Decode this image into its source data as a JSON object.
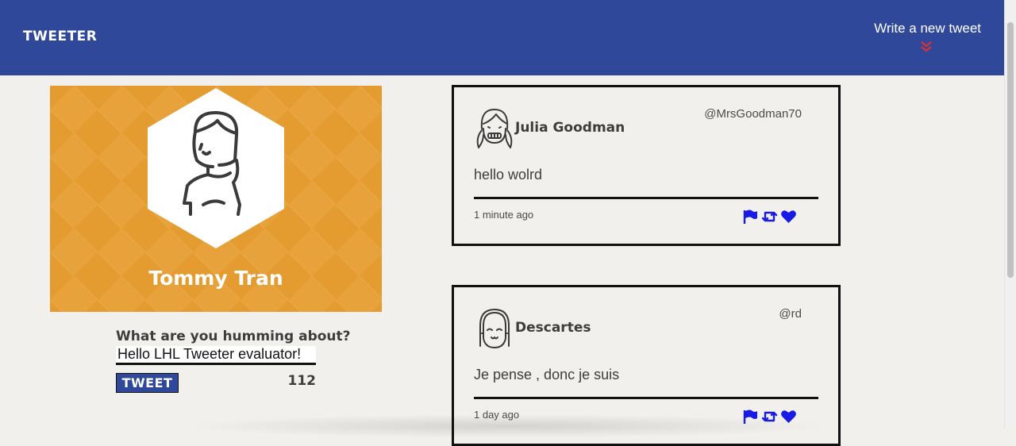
{
  "navbar": {
    "brand": "TWEETER",
    "compose_link": "Write a new tweet",
    "chevron_icon": "double-chevron-down-icon",
    "chevron_color": "#e03030"
  },
  "profile": {
    "name": "Tommy Tran",
    "avatar_icon": "user-avatar-icon",
    "background_color": "#e49b2f"
  },
  "compose": {
    "label": "What are you humming about?",
    "input_value": "Hello LHL Tweeter evaluator!",
    "button_label": "TWEET",
    "counter": "112"
  },
  "tweets": [
    {
      "name": "Julia Goodman",
      "handle": "@MrsGoodman70",
      "body": "hello wolrd",
      "time": "1 minute ago",
      "avatar_icon": "girl-avatar-icon"
    },
    {
      "name": "Descartes",
      "handle": "@rd",
      "body": "Je pense , donc je suis",
      "time": "1 day ago",
      "avatar_icon": "bob-haircut-avatar-icon"
    }
  ],
  "actions": {
    "icons": [
      "flag-icon",
      "retweet-icon",
      "heart-icon"
    ],
    "color": "#1a1ae6"
  },
  "colors": {
    "navbar": "#2f4899",
    "page_background": "#f2f0ec",
    "profile_background": "#e49b2f"
  }
}
